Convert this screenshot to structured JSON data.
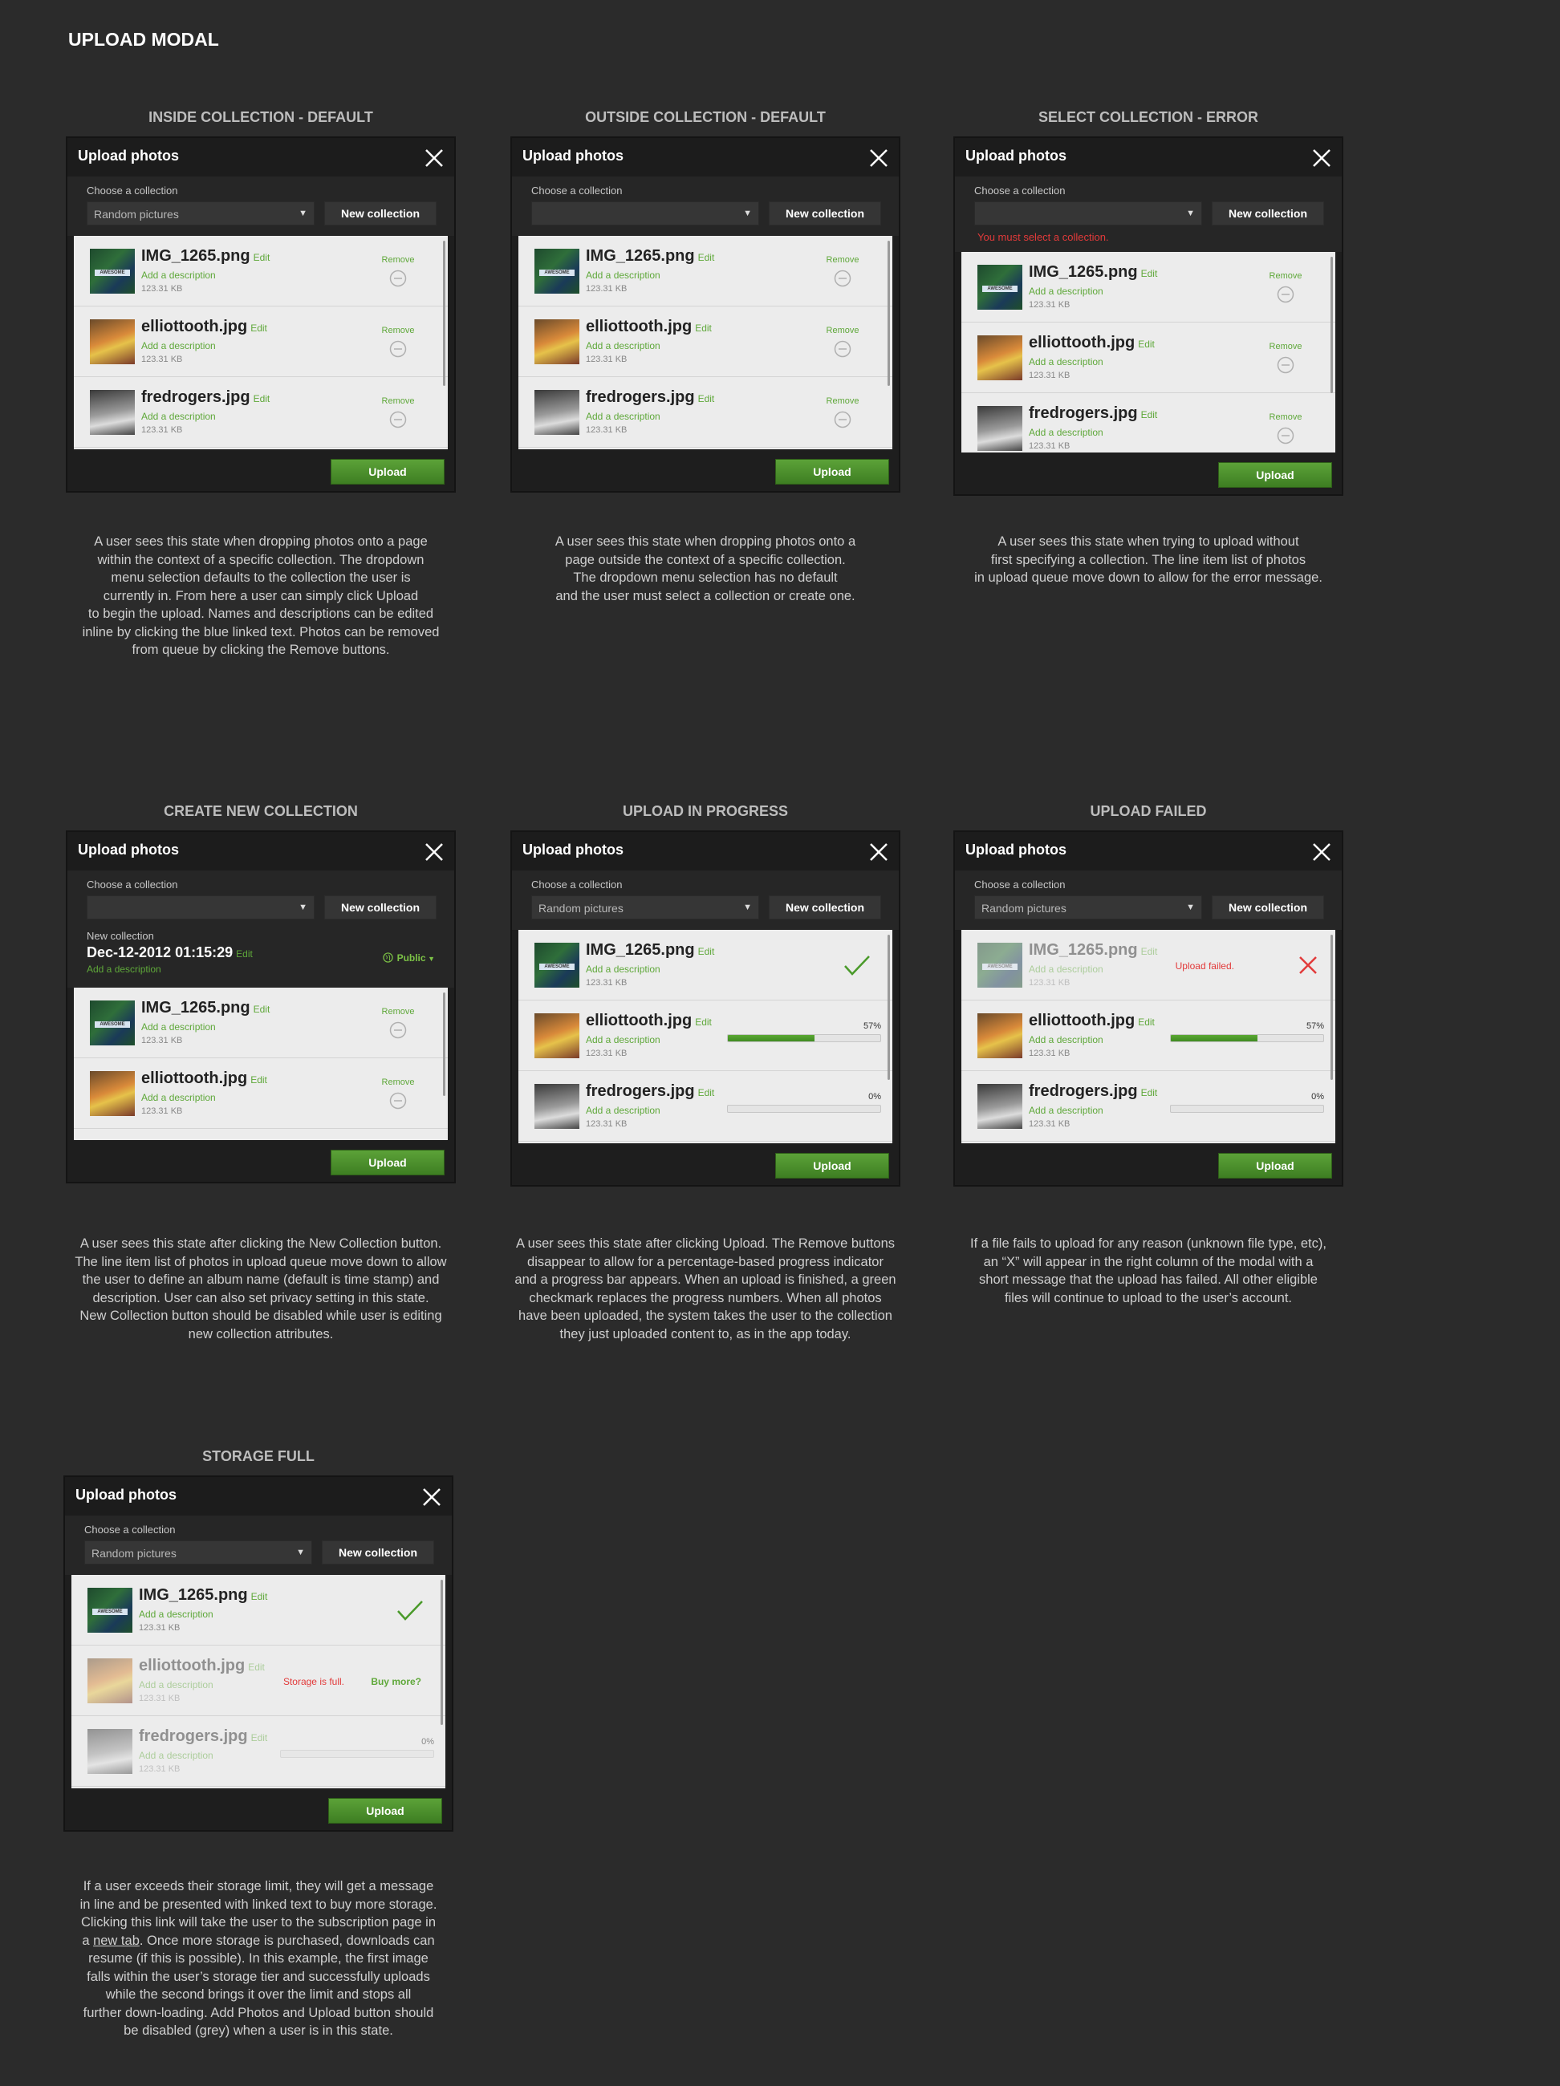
{
  "page_title": "UPLOAD MODAL",
  "modal_title": "Upload photos",
  "choose_label": "Choose a collection",
  "new_collection_label": "New collection",
  "upload_label": "Upload",
  "edit_label": "Edit",
  "add_description": "Add a description",
  "remove_label": "Remove",
  "file_size": "123.31 KB",
  "files": [
    "IMG_1265.png",
    "elliottooth.jpg",
    "fredrogers.jpg"
  ],
  "thumb_tag": "AWESOME",
  "colors": {
    "accent_green": "#5fa83a",
    "error_red": "#e23a3a",
    "background": "#2b2b2b"
  },
  "panels": {
    "p1": {
      "title": "INSIDE COLLECTION - DEFAULT",
      "dropdown_value": "Random pictures",
      "desc": [
        "A user sees this state when dropping photos onto a  page",
        "within the context of a specific collection.  The dropdown",
        "menu selection defaults to the collection the user is",
        "currently in. From here a user can simply click Upload",
        "to begin the upload. Names and descriptions can be edited",
        "inline by clicking the blue linked text. Photos can be removed",
        "from queue by clicking the Remove buttons."
      ]
    },
    "p2": {
      "title": "OUTSIDE COLLECTION - DEFAULT",
      "dropdown_value": "",
      "desc": [
        "A user sees this state when dropping photos onto a",
        "page outside the context of a specific collection.",
        "The dropdown menu selection has no default",
        "and the user must select a collection or create one."
      ]
    },
    "p3": {
      "title": "SELECT COLLECTION - ERROR",
      "dropdown_value": "",
      "error": "You must select a collection.",
      "desc": [
        "A user sees this state when trying to upload without",
        "first specifying a collection. The line item list of photos",
        "in upload queue move down to allow for the error message."
      ]
    },
    "p4": {
      "title": "CREATE NEW COLLECTION",
      "dropdown_value": "",
      "nc_label": "New collection",
      "nc_name": "Dec-12-2012 01:15:29",
      "public_label": "Public",
      "desc": [
        "A user sees this state after clicking the New Collection button.",
        "The line item list of photos in upload queue move down to allow",
        "the user to define an album name (default is time stamp) and",
        "description. User can also set privacy setting in this state.",
        "New Collection button should be disabled while user is editing",
        "new collection attributes."
      ]
    },
    "p5": {
      "title": "UPLOAD IN PROGRESS",
      "dropdown_value": "Random pictures",
      "progress": [
        {
          "label": "57%",
          "value": 57
        },
        {
          "label": "0%",
          "value": 0
        }
      ],
      "desc": [
        "A user sees this state after clicking Upload. The Remove buttons",
        "disappear to allow for a percentage-based progress indicator",
        "and a progress bar appears. When an upload is finished, a green",
        "checkmark replaces the progress numbers. When all photos",
        "have been uploaded, the system takes the user to the collection",
        "they just uploaded content to, as in the app today."
      ]
    },
    "p6": {
      "title": "UPLOAD FAILED",
      "dropdown_value": "Random pictures",
      "failed_msg": "Upload failed.",
      "progress": [
        {
          "label": "57%",
          "value": 57
        },
        {
          "label": "0%",
          "value": 0
        }
      ],
      "desc": [
        "If a file fails to upload for any reason (unknown file type, etc),",
        "an “X” will appear in the right column of the modal with a",
        "short message that the upload has failed. All other eligible",
        "files will continue to upload to the user’s account."
      ]
    },
    "p7": {
      "title": "STORAGE FULL",
      "dropdown_value": "Random pictures",
      "storage_msg": "Storage is full.",
      "buy_more": "Buy more?",
      "progress": [
        {
          "label": "0%",
          "value": 0
        }
      ],
      "desc_line4_pre": "a ",
      "desc_line4_link": "new tab",
      "desc_line4_post": ". Once more storage is purchased, downloads can",
      "desc": [
        "If a user exceeds their storage limit, they will get a message",
        "in line and be presented with linked text to buy more storage.",
        "Clicking this link will take the user to the subscription page in",
        "resume (if this is possible). In this example, the first image",
        "falls within the user’s storage tier and successfully uploads",
        "while the second brings it over the limit and stops all",
        "further down-loading. Add Photos and Upload button should",
        "be disabled (grey) when a user is in this state."
      ]
    }
  }
}
